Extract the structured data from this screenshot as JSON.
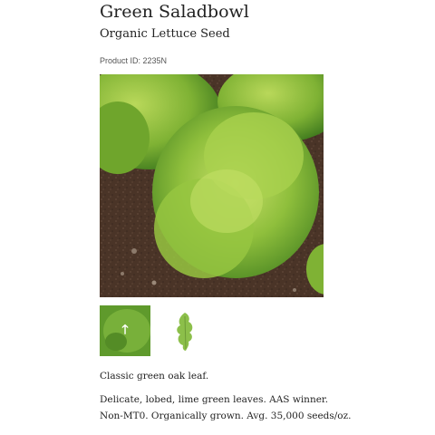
{
  "product": {
    "title": "Green Saladbowl",
    "subtitle": "Organic Lettuce Seed",
    "product_id": "Product ID: 2235N"
  },
  "gallery": {
    "main_image": "green-saladbowl-lettuce-row-photo",
    "thumbnails": [
      {
        "name": "lettuce-row-photo-thumbnail",
        "icon": "up-arrow-icon",
        "icon_glyph": "🡑"
      },
      {
        "name": "lettuce-leaf-thumbnail"
      }
    ]
  },
  "description": {
    "short": "Classic green oak leaf.",
    "line1": "Delicate, lobed, lime green leaves. AAS winner.",
    "line2": "Non-MT0. Organically grown. Avg. 35,000 seeds/oz."
  }
}
